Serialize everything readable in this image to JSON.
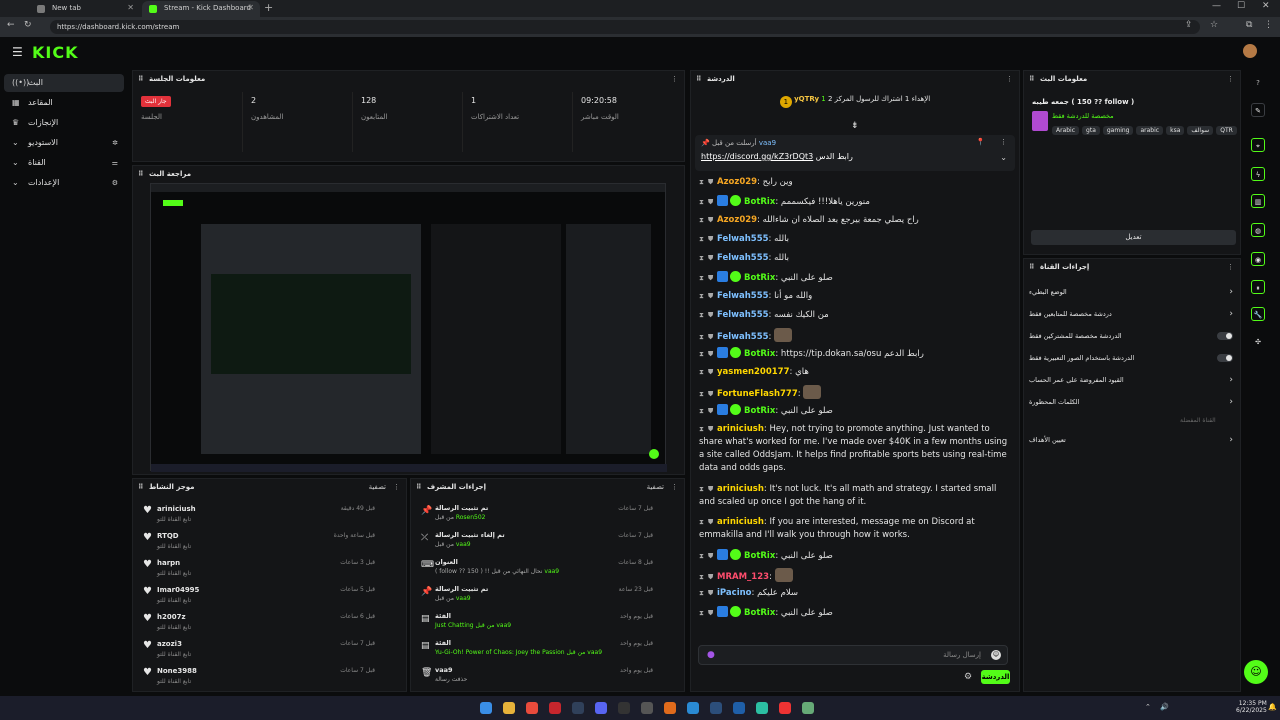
{
  "browser": {
    "tabs": [
      {
        "label": "New tab"
      },
      {
        "label": "Stream - Kick Dashboard"
      }
    ],
    "url": "https://dashboard.kick.com/stream"
  },
  "brand": {
    "logo": "KICK",
    "accent": "#53fc18"
  },
  "sidebar": {
    "items": [
      {
        "label": "البث",
        "icon": "broadcast-icon"
      },
      {
        "label": "المقاعد",
        "icon": "grid-icon"
      },
      {
        "label": "الإنجازات",
        "icon": "trophy-icon"
      },
      {
        "label": "الاستوديو",
        "icon": "studio-icon"
      },
      {
        "label": "القناة",
        "icon": "channel-icon"
      },
      {
        "label": "الإعدادات",
        "icon": "gear-icon"
      }
    ]
  },
  "session": {
    "title": "معلومات الجلسة",
    "stats": [
      {
        "value": "جار البث",
        "label": "الجلسة"
      },
      {
        "value": "2",
        "label": "المشاهدون"
      },
      {
        "value": "128",
        "label": "المتابعون"
      },
      {
        "value": "1",
        "label": "تعداد الاشتراكات"
      },
      {
        "value": "09:20:58",
        "label": "الوقت مباشر"
      }
    ]
  },
  "preview": {
    "title": "مراجعة البث"
  },
  "feed": {
    "title": "موجز النشاط",
    "filter": "تصفية",
    "items": [
      {
        "name": "ariniciush",
        "sub": "تابع القناة للتو",
        "time": "قبل 49 دقيقة"
      },
      {
        "name": "RTQD",
        "sub": "تابع القناة للتو",
        "time": "قبل ساعة واحدة"
      },
      {
        "name": "harpn",
        "sub": "تابع القناة للتو",
        "time": "قبل 3 ساعات"
      },
      {
        "name": "Imar04995",
        "sub": "تابع القناة للتو",
        "time": "قبل 5 ساعات"
      },
      {
        "name": "h2007z",
        "sub": "تابع القناة للتو",
        "time": "قبل 6 ساعات"
      },
      {
        "name": "azozi3",
        "sub": "تابع القناة للتو",
        "time": "قبل 7 ساعات"
      },
      {
        "name": "None3988",
        "sub": "تابع القناة للتو",
        "time": "قبل 7 ساعات"
      }
    ]
  },
  "mod": {
    "title": "إجراءات المشرف",
    "filter": "تصفية",
    "items": [
      {
        "title": "تم تثبيت الرسالة",
        "sub": "من قبل",
        "user": "Rosen502",
        "time": "قبل 7 ساعات",
        "icon": "pin-icon"
      },
      {
        "title": "تم إلغاء تثبيت الرسالة",
        "sub": "من قبل",
        "user": "vaa9",
        "time": "قبل 7 ساعات",
        "icon": "unpin-icon"
      },
      {
        "title": "العنوان",
        "sub": "( follow ?? 150 ) !! نحال النهائي من قبل",
        "user": "vaa9",
        "time": "قبل 8 ساعات",
        "icon": "title-icon"
      },
      {
        "title": "تم تثبيت الرسالة",
        "sub": "من قبل",
        "user": "vaa9",
        "time": "قبل 23 ساعة",
        "icon": "pin-icon"
      },
      {
        "title": "الفئة",
        "sub": "Just Chatting من قبل",
        "user": "vaa9",
        "time": "قبل يوم واحد",
        "icon": "category-icon"
      },
      {
        "title": "الفئة",
        "sub": "Yu-Gi-Oh! Power of Chaos: Joey the Passion من قبل",
        "user": "vaa9",
        "time": "قبل يوم واحد",
        "icon": "category-icon"
      },
      {
        "title": "vaa9",
        "sub": "حذفت رسالة",
        "user": "",
        "time": "قبل يوم واحد",
        "icon": "trash-icon"
      }
    ]
  },
  "chat": {
    "title": "الدردشة",
    "goal_user": "yQTRy",
    "goal_text": "الإهداء 1 اشتراك للرسول المركز 2",
    "goal_count": "1",
    "pinned_by": "vaa9",
    "pinned_label": "أرسلت من قبل",
    "pinned_link": "https://discord.gg/kZ3rDQt3",
    "pinned_prefix": "رابط الدس",
    "messages": [
      {
        "user": "Azoz029",
        "color": "#f5a623",
        "text": "وين رايح"
      },
      {
        "user": "BotRix",
        "color": "#53fc18",
        "text": "منورين ياهلا!!! فيكسممم"
      },
      {
        "user": "Azoz029",
        "color": "#f5a623",
        "text": "راح يصلي جمعة بيرجع بعد الصلاه ان شاءالله"
      },
      {
        "user": "Felwah555",
        "color": "#7ec0ff",
        "text": "بالله"
      },
      {
        "user": "Felwah555",
        "color": "#7ec0ff",
        "text": "بالله"
      },
      {
        "user": "BotRix",
        "color": "#53fc18",
        "text": "صلو على النبي"
      },
      {
        "user": "Felwah555",
        "color": "#7ec0ff",
        "text": "والله مو أنا"
      },
      {
        "user": "Felwah555",
        "color": "#7ec0ff",
        "text": "من الكيك نفسه"
      },
      {
        "user": "Felwah555",
        "color": "#7ec0ff",
        "text": ""
      },
      {
        "user": "BotRix",
        "color": "#53fc18",
        "text": "https://tip.dokan.sa/osu رابط الدعم"
      },
      {
        "user": "yasmen200177",
        "color": "#ffd700",
        "text": "هاي"
      },
      {
        "user": "FortuneFlash777",
        "color": "#ffd700",
        "text": ""
      },
      {
        "user": "BotRix",
        "color": "#53fc18",
        "text": "صلو على النبي"
      },
      {
        "user": "ariniciush",
        "color": "#ffd700",
        "text": "Hey, not trying to promote anything. Just wanted to share what's worked for me. I've made over $40K in a few months using a site called OddsJam. It helps find profitable sports bets using real-time data and odds gaps."
      },
      {
        "user": "ariniciush",
        "color": "#ffd700",
        "text": "It's not luck. It's all math and strategy. I started small and scaled up once I got the hang of it."
      },
      {
        "user": "ariniciush",
        "color": "#ffd700",
        "text": "If you are interested, message me on Discord at emmakilla and I'll walk you through how it works."
      },
      {
        "user": "BotRix",
        "color": "#53fc18",
        "text": "صلو على النبي"
      },
      {
        "user": "MRAM_123",
        "color": "#ff4d6d",
        "text": ""
      },
      {
        "user": "iPacino",
        "color": "#7ec0ff",
        "text": "سلام عليكم"
      },
      {
        "user": "BotRix",
        "color": "#53fc18",
        "text": "صلو على النبي"
      }
    ],
    "input_placeholder": "إرسال رسالة",
    "send_label": "الدردشة"
  },
  "stream_info": {
    "title": "معلومات البث",
    "stream_title": "جمعه طيبه ( 150 ?? follow )",
    "category": "مخصصة للدردشة فقط",
    "tags": [
      "Arabic",
      "gta",
      "gaming",
      "arabic",
      "ksa",
      "سوالف",
      "QTR"
    ],
    "edit_label": "تعديل"
  },
  "channel_actions": {
    "title": "إجراءات القناة",
    "rows": [
      {
        "label": "الوضع البطيء",
        "type": "chevron"
      },
      {
        "label": "دردشة مخصصة للمتابعين فقط",
        "type": "chevron"
      },
      {
        "label": "الدردشة مخصصة للمشتركين فقط",
        "type": "toggle"
      },
      {
        "label": "الدردشة باستخدام الصور التعبيرية فقط",
        "type": "toggle"
      },
      {
        "label": "القيود المفروضة على عمر الحساب",
        "type": "chevron"
      },
      {
        "label": "الكلمات المحظورة",
        "type": "chevron"
      }
    ],
    "section": "القناة المفضلة",
    "goal_row": "تعيين الأهداف"
  },
  "taskbar": {
    "time": "12:35 PM",
    "date": "6/22/2025"
  }
}
